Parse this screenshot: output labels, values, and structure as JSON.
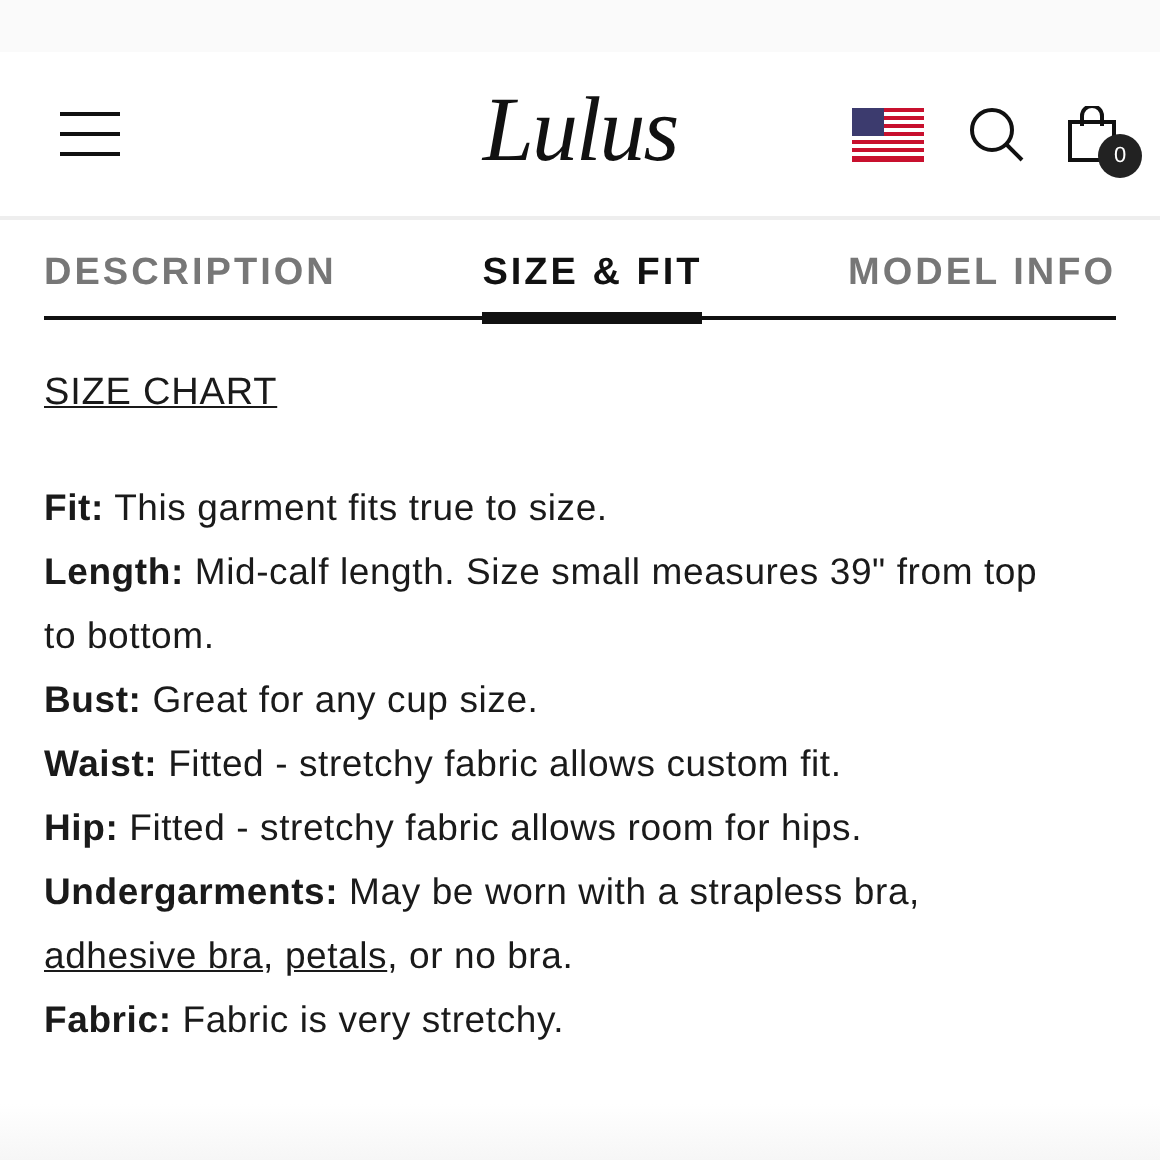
{
  "header": {
    "logo": "Lulus",
    "cart_count": "0"
  },
  "tabs": [
    {
      "label": "DESCRIPTION",
      "selected": false
    },
    {
      "label": "SIZE & FIT",
      "selected": true
    },
    {
      "label": "MODEL INFO",
      "selected": false
    }
  ],
  "size_chart_link": "SIZE CHART",
  "details": [
    {
      "label": "Fit:",
      "parts": [
        {
          "text": " This garment fits true to size.",
          "link": false
        }
      ]
    },
    {
      "label": "Length:",
      "parts": [
        {
          "text": " Mid-calf length. Size small measures 39\" from top to bottom.",
          "link": false
        }
      ]
    },
    {
      "label": "Bust:",
      "parts": [
        {
          "text": " Great for any cup size.",
          "link": false
        }
      ]
    },
    {
      "label": "Waist:",
      "parts": [
        {
          "text": " Fitted - stretchy fabric allows custom fit.",
          "link": false
        }
      ]
    },
    {
      "label": "Hip:",
      "parts": [
        {
          "text": " Fitted - stretchy fabric allows room for hips.",
          "link": false
        }
      ]
    },
    {
      "label": "Undergarments:",
      "parts": [
        {
          "text": " May be worn with a strapless bra, ",
          "link": false
        },
        {
          "text": "adhesive bra",
          "link": true
        },
        {
          "text": ", ",
          "link": false
        },
        {
          "text": "petals",
          "link": true
        },
        {
          "text": ", or no bra.",
          "link": false
        }
      ]
    },
    {
      "label": "Fabric:",
      "parts": [
        {
          "text": " Fabric is very stretchy.",
          "link": false
        }
      ]
    }
  ]
}
